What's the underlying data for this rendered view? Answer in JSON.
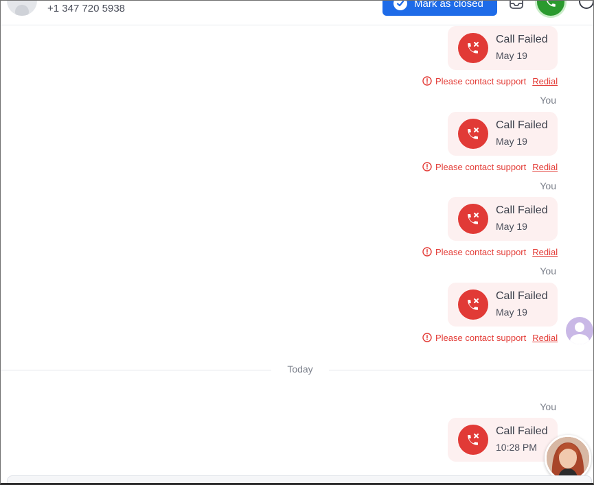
{
  "header": {
    "phone": "+1 347 720 5938",
    "mark_closed_label": "Mark as closed"
  },
  "messages": [
    {
      "title": "Call Failed",
      "date": "May 19",
      "error": "Please contact support",
      "redial": "Redial",
      "sender": "You"
    },
    {
      "title": "Call Failed",
      "date": "May 19",
      "error": "Please contact support",
      "redial": "Redial",
      "sender": "You"
    },
    {
      "title": "Call Failed",
      "date": "May 19",
      "error": "Please contact support",
      "redial": "Redial",
      "sender": "You"
    },
    {
      "title": "Call Failed",
      "date": "May 19",
      "error": "Please contact support",
      "redial": "Redial"
    }
  ],
  "divider": {
    "label": "Today"
  },
  "today_messages": [
    {
      "sender": "You",
      "title": "Call Failed",
      "date": "10:28 PM"
    }
  ],
  "colors": {
    "accent": "#1e6be8",
    "call_green": "#2a9a2e",
    "error_red": "#e33b36",
    "card_bg": "#fdf0f0"
  }
}
